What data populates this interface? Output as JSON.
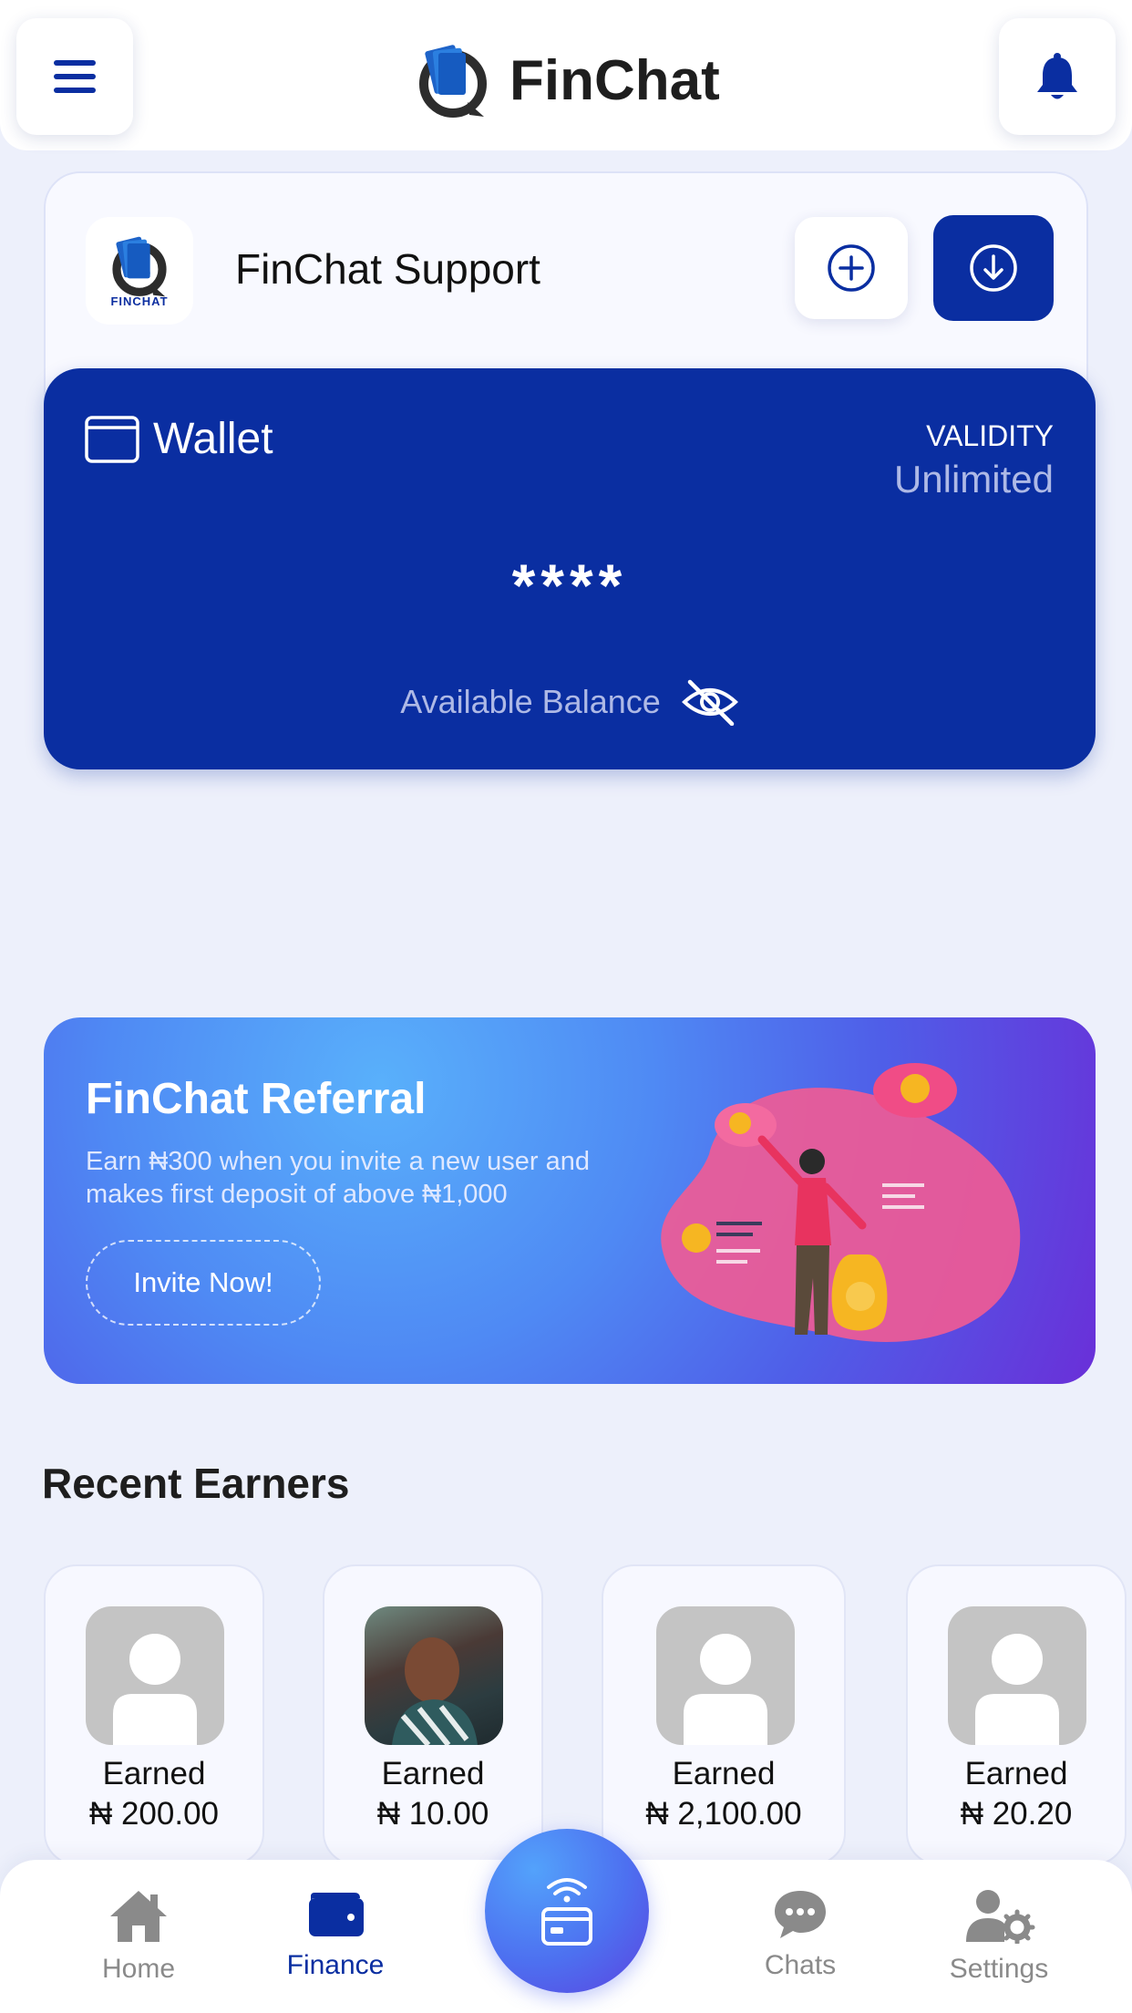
{
  "header": {
    "title": "FinChat",
    "menu_icon": "hamburger-menu-icon",
    "bell_icon": "bell-icon"
  },
  "support": {
    "logo_caption": "FINCHAT",
    "name": "FinChat Support",
    "add_icon": "plus-circle-icon",
    "download_icon": "download-circle-icon"
  },
  "wallet": {
    "title": "Wallet",
    "validity_label": "VALIDITY",
    "validity_value": "Unlimited",
    "balance": "****",
    "balance_label": "Available Balance",
    "visibility_icon": "eye-slash-icon"
  },
  "referral": {
    "title": "FinChat Referral",
    "description": "Earn ₦300 when you invite a new user and makes first deposit of above ₦1,000",
    "button_label": "Invite Now!"
  },
  "recent_earners": {
    "title": "Recent Earners",
    "items": [
      {
        "label": "Earned",
        "amount": "₦ 200.00",
        "avatar": "default"
      },
      {
        "label": "Earned",
        "amount": "₦ 10.00",
        "avatar": "photo"
      },
      {
        "label": "Earned",
        "amount": "₦ 2,100.00",
        "avatar": "default"
      },
      {
        "label": "Earned",
        "amount": "₦ 20.20",
        "avatar": "default"
      }
    ]
  },
  "bottom_nav": {
    "items": [
      {
        "label": "Home",
        "icon": "home-icon",
        "active": false
      },
      {
        "label": "Finance",
        "icon": "wallet-icon",
        "active": true
      },
      {
        "label": "Chats",
        "icon": "chat-bubble-icon",
        "active": false
      },
      {
        "label": "Settings",
        "icon": "user-gear-icon",
        "active": false
      }
    ],
    "center_icon": "contactless-card-icon"
  },
  "colors": {
    "primary": "#0a2ea1",
    "background": "#edf0fb",
    "muted_text": "#8a8a8a"
  }
}
